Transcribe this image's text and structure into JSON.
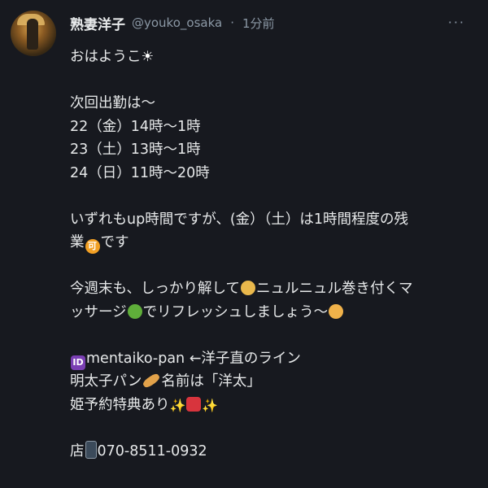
{
  "tweet": {
    "name": "熟妻洋子",
    "handle": "@youko_osaka",
    "separator": "·",
    "time": "1分前",
    "more": "···",
    "lines": {
      "greeting_text": "おはようこ",
      "greeting_sun": "☀",
      "schedule_title": "次回出勤は〜",
      "day1": "22（金）14時〜1時",
      "day2": "23（土）13時〜1時",
      "day3": "24（日）11時〜20時",
      "note_a": "いずれもup時間ですが、(金）（土）は1時間程度の残",
      "note_b_pre": "業",
      "note_b_emoji": "可",
      "note_b_post": "です",
      "weekend_a_pre": "今週末も、しっかり解して",
      "weekend_a_post": "ニュルニュル巻き付くマ",
      "weekend_b_pre": "ッサージ",
      "weekend_b_post": "でリフレッシュしましょう〜",
      "line_id_emoji": "ID",
      "line_id": "mentaiko-pan ←洋子直のライン",
      "mentaiko_pre": "明太子パン",
      "mentaiko_post": "名前は「洋太」",
      "hime_pre": "姫予約特典あり",
      "spark": "✨",
      "shop_pre": "店",
      "shop_phone": "070-8511-0932"
    },
    "icons": {
      "sun": "sun-emoji",
      "id": "id-button-emoji",
      "ka": "ok-circle-emoji",
      "massage": "massage-emoji",
      "snake": "snake-emoji",
      "woman": "woman-raising-hand-emoji",
      "bread": "baguette-emoji",
      "sparkles": "sparkles-emoji",
      "gift": "gift-emoji",
      "phone": "mobile-phone-emoji"
    },
    "colors": {
      "background": "#17191f",
      "text": "#e7e9ea",
      "muted": "#8b98a5"
    }
  }
}
